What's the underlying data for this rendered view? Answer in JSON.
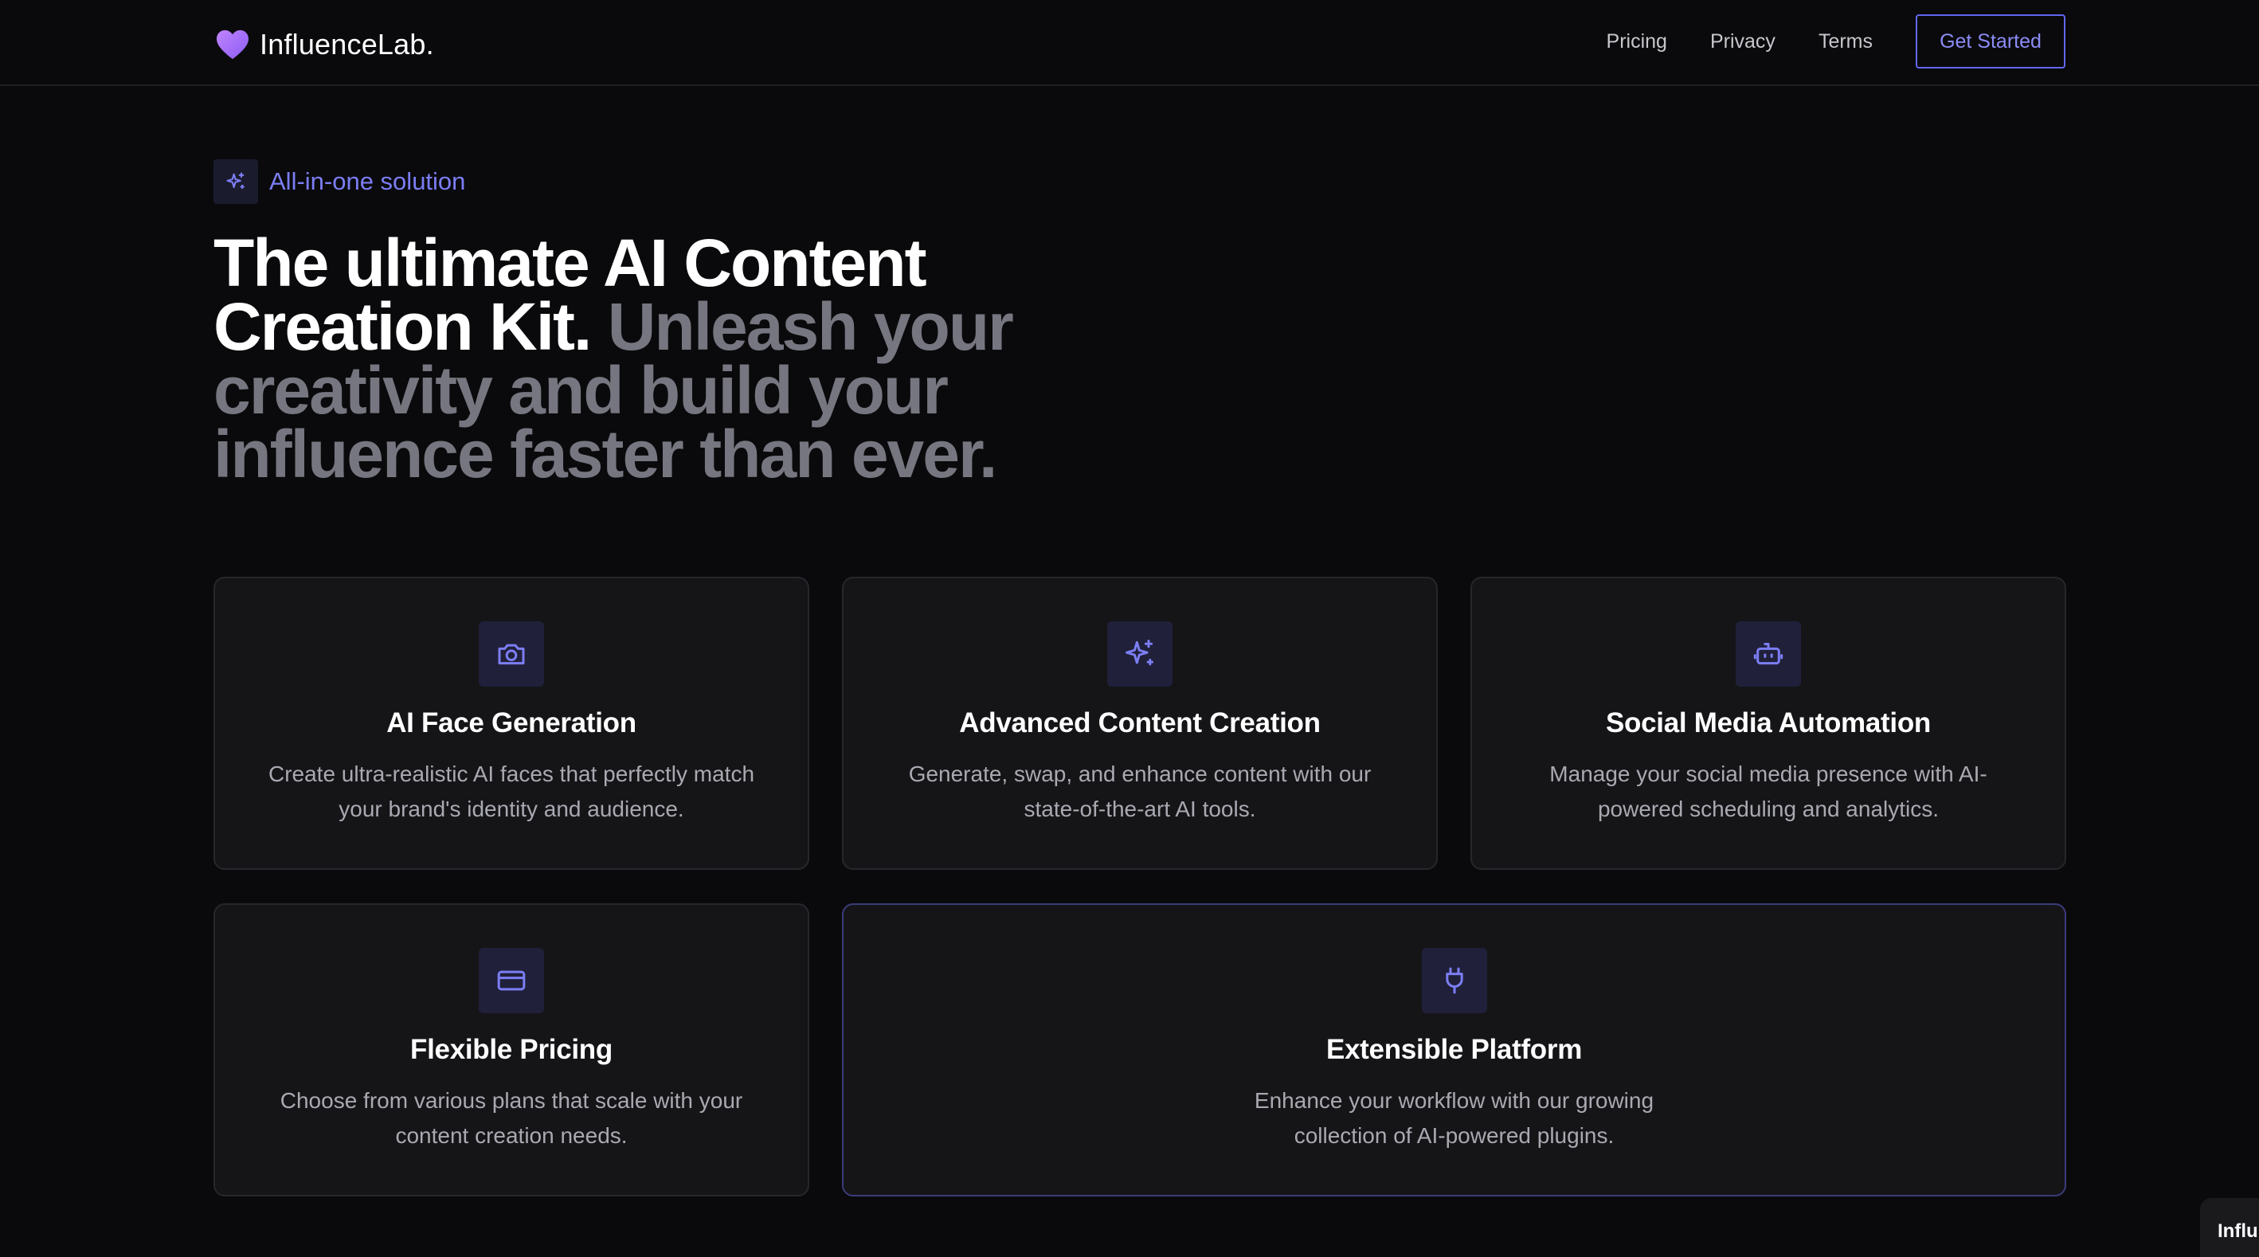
{
  "brand": {
    "name": "InfluenceLab."
  },
  "nav": {
    "links": [
      "Pricing",
      "Privacy",
      "Terms"
    ],
    "cta_label": "Get Started"
  },
  "hero": {
    "badge": "All-in-one solution",
    "title_strong": "The ultimate AI Content Creation Kit.",
    "title_muted": "Unleash your creativity and build your influence faster than ever."
  },
  "features": [
    {
      "icon": "camera-icon",
      "title": "AI Face Generation",
      "description": "Create ultra-realistic AI faces that perfectly match your brand's identity and audience."
    },
    {
      "icon": "sparkles-icon",
      "title": "Advanced Content Creation",
      "description": "Generate, swap, and enhance content with our state-of-the-art AI tools."
    },
    {
      "icon": "bot-icon",
      "title": "Social Media Automation",
      "description": "Manage your social media presence with AI-powered scheduling and analytics."
    },
    {
      "icon": "credit-card-icon",
      "title": "Flexible Pricing",
      "description": "Choose from various plans that scale with your content creation needs."
    },
    {
      "icon": "plug-icon",
      "title": "Extensible Platform",
      "description": "Enhance your workflow with our growing collection of AI-powered plugins."
    }
  ],
  "toast": {
    "text": "Influ"
  },
  "colors": {
    "background": "#0a0a0c",
    "accent": "#6366f1",
    "card": "#151518",
    "muted_text": "#767680"
  }
}
